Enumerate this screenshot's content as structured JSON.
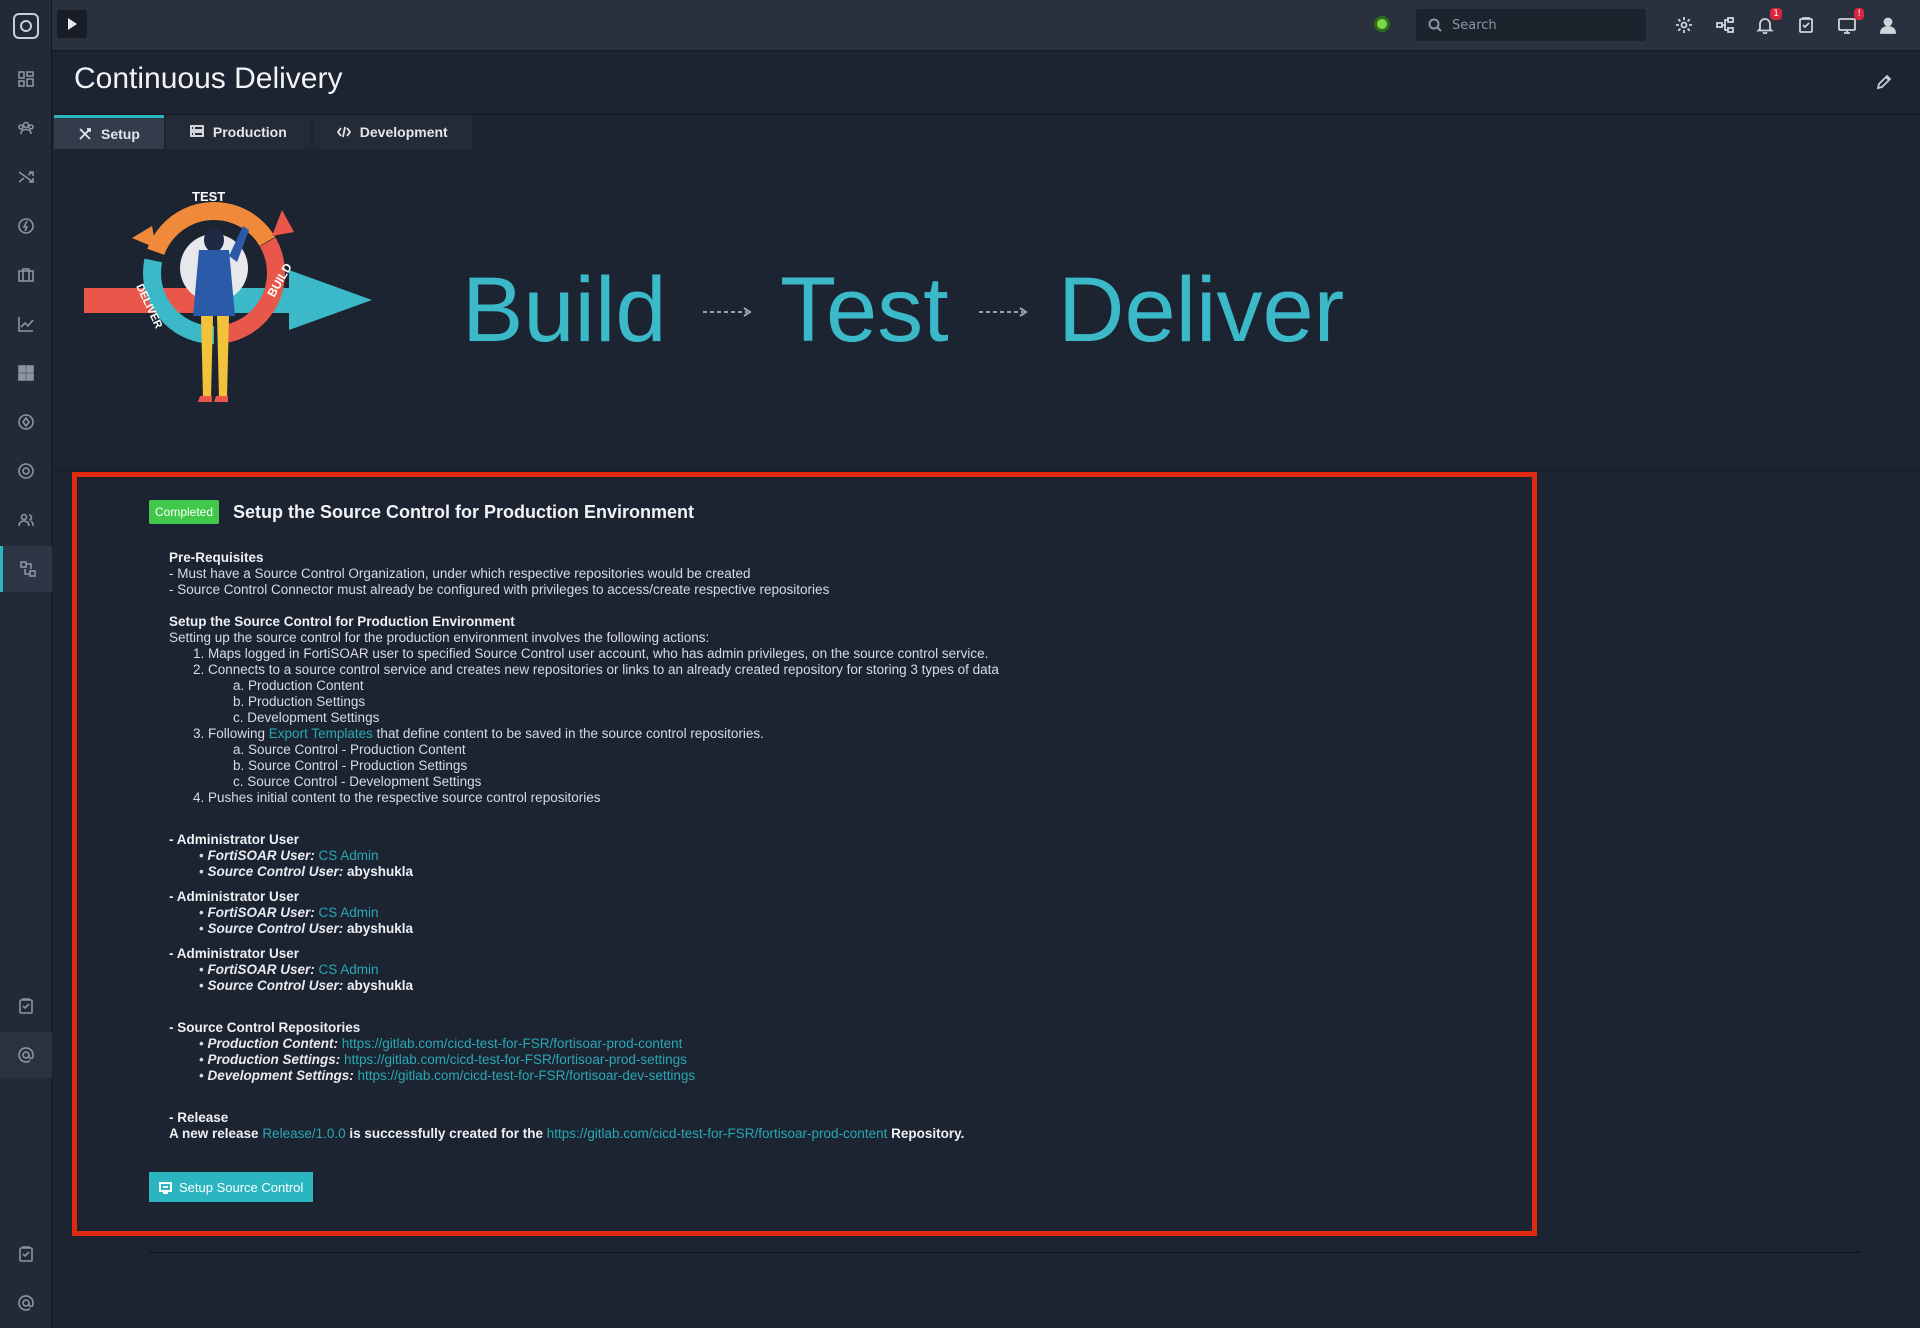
{
  "app": {
    "logo_icon": "fortisoar-logo-icon"
  },
  "sidebar": {
    "items": [
      {
        "icon": "dashboard-icon"
      },
      {
        "icon": "team-icon"
      },
      {
        "icon": "shuffle-icon"
      },
      {
        "icon": "lightning-icon"
      },
      {
        "icon": "briefcase-icon"
      },
      {
        "icon": "chart-icon"
      },
      {
        "icon": "apps-icon"
      },
      {
        "icon": "shield-icon"
      },
      {
        "icon": "globe-icon"
      },
      {
        "icon": "users-icon"
      },
      {
        "icon": "source-control-icon",
        "active": true
      }
    ],
    "bottom_items": [
      {
        "icon": "clipboard-icon"
      },
      {
        "icon": "at-icon"
      },
      {
        "icon": "clipboard-icon"
      },
      {
        "icon": "at-icon"
      }
    ]
  },
  "topbar": {
    "search_placeholder": "Search",
    "notifications_badge": "1",
    "system_badge": "!"
  },
  "page": {
    "title": "Continuous Delivery",
    "tabs": [
      {
        "label": "Setup",
        "active": true
      },
      {
        "label": "Production",
        "active": false
      },
      {
        "label": "Development",
        "active": false
      }
    ]
  },
  "hero": {
    "circle_labels": [
      "TEST",
      "BUILD",
      "DELIVER"
    ],
    "words": [
      "Build",
      "Test",
      "Deliver"
    ]
  },
  "setup": {
    "status": "Completed",
    "title": "Setup the Source Control for Production Environment",
    "prereq_heading": "Pre-Requisites",
    "prereq": [
      "- Must have a Source Control Organization, under which respective repositories would be created",
      "- Source Control Connector must already be configured with privileges to access/create respective repositories"
    ],
    "section_heading": "Setup the Source Control for Production Environment",
    "intro": "Setting up the source control for the production environment involves the following actions:",
    "step1": "1. Maps logged in FortiSOAR user to specified Source Control user account, who has admin privileges, on the source control service.",
    "step2": "2. Connects to a source control service and creates new repositories or links to an already created repository for storing 3 types of data",
    "step2_items": [
      "a. Production Content",
      "b. Production Settings",
      "c. Development Settings"
    ],
    "step3_prefix": "3. Following ",
    "step3_link": "Export Templates",
    "step3_suffix": " that define content to be saved in the source control repositories.",
    "step3_items": [
      "a. Source Control - Production Content",
      "b. Source Control - Production Settings",
      "c. Source Control - Development Settings"
    ],
    "step4": "4. Pushes initial content to the respective source control repositories",
    "admin_heading": "- Administrator User",
    "admin_fsr_label": "FortiSOAR User:",
    "admin_fsr_value": "CS Admin",
    "admin_sc_label": "Source Control User:",
    "admin_sc_value": "abyshukla",
    "repos_heading": "- Source Control Repositories",
    "repos": [
      {
        "label": "Production Content:",
        "url": "https://gitlab.com/cicd-test-for-FSR/fortisoar-prod-content"
      },
      {
        "label": "Production Settings:",
        "url": "https://gitlab.com/cicd-test-for-FSR/fortisoar-prod-settings"
      },
      {
        "label": "Development Settings:",
        "url": "https://gitlab.com/cicd-test-for-FSR/fortisoar-dev-settings"
      }
    ],
    "release_heading": "- Release",
    "release_prefix": "A new release ",
    "release_link": "Release/1.0.0",
    "release_mid": " is successfully created for the ",
    "release_repo": "https://gitlab.com/cicd-test-for-FSR/fortisoar-prod-content",
    "release_suffix": " Repository.",
    "button": "Setup Source Control"
  }
}
